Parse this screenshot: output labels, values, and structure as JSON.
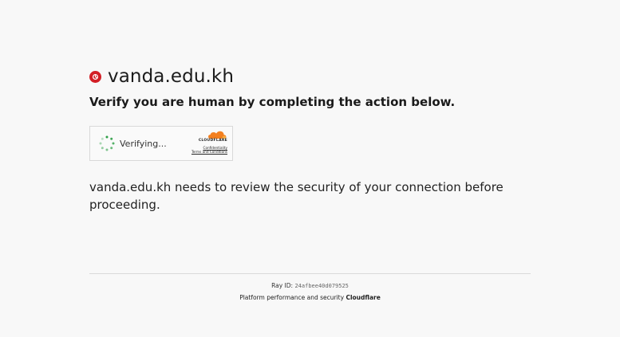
{
  "site": {
    "name": "vanda.edu.kh"
  },
  "challenge": {
    "title": "Verify you are human by completing the action below.",
    "status": "Verifying...",
    "brand": "CLOUDFLARE",
    "privacy_link": "Confidentiality",
    "terms_link": "Terms and Conditions"
  },
  "message": "vanda.edu.kh needs to review the security of your connection before proceeding.",
  "footer": {
    "ray_label": "Ray ID:",
    "ray_id": "24afbee40d079525",
    "performance_text": "Platform performance and security",
    "provider": "Cloudflare"
  },
  "colors": {
    "favicon": "#d31f26",
    "cloud_orange": "#f38020",
    "cloud_light": "#faad3f",
    "spinner": "#2c9f45"
  },
  "icons": {
    "favicon": "site-favicon-icon",
    "spinner": "loading-spinner-icon",
    "cloud": "cloudflare-cloud-icon"
  }
}
